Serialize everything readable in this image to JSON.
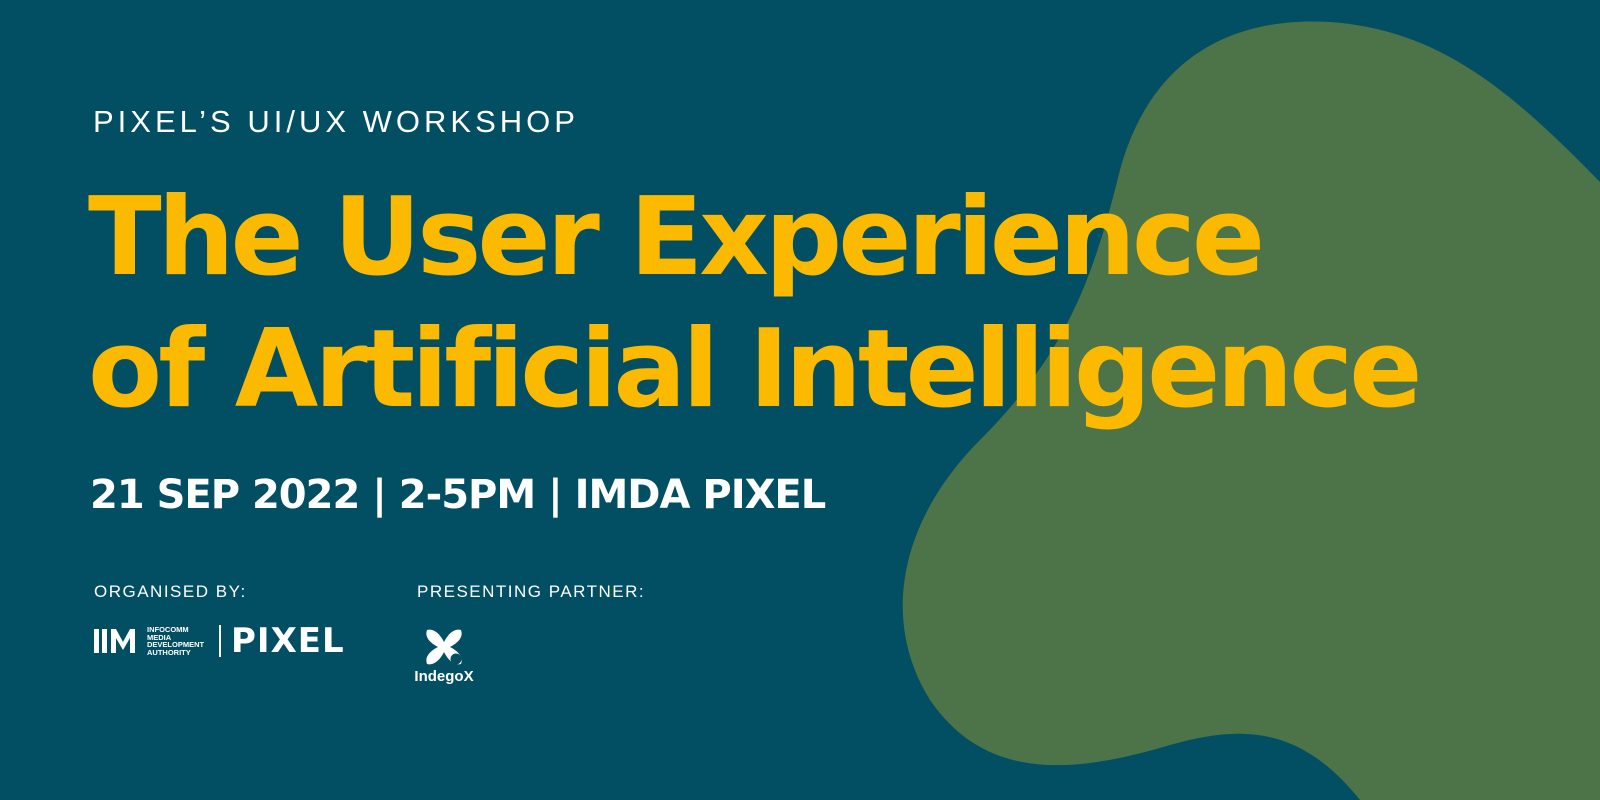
{
  "colors": {
    "background": "#024f63",
    "blob": "#4d7348",
    "accent": "#fbb900",
    "text": "#ffffff"
  },
  "eyebrow": "PIXEL’S UI/UX WORKSHOP",
  "title": {
    "line1": "The User Experience",
    "line2": "of Artificial Intelligence"
  },
  "dateline": "21 SEP 2022 | 2-5PM | IMDA PIXEL",
  "organiser": {
    "label": "ORGANISED BY:",
    "imda_lines": [
      "INFOCOMM",
      "MEDIA",
      "DEVELOPMENT",
      "AUTHORITY"
    ],
    "pixel_wordmark": "PIXEL"
  },
  "partner": {
    "label": "PRESENTING PARTNER:",
    "name": "IndegoX"
  }
}
